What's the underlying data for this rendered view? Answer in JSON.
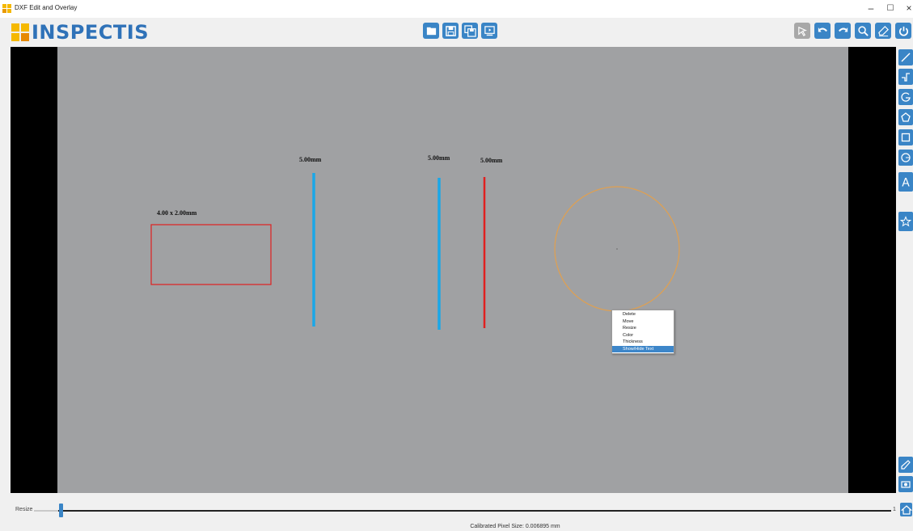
{
  "window": {
    "title": "DXF Edit and Overlay",
    "minimize": "–",
    "maximize": "☐",
    "close": "×"
  },
  "brand": {
    "logo_text": "INSPECTIS",
    "accent": "#2f72b8",
    "logo_color": "#f5b800"
  },
  "toolbar_center": [
    "folder-open-icon",
    "save-icon",
    "save-as-icon",
    "overlay-display-icon"
  ],
  "toolbar_right": [
    "select-arrow-icon",
    "undo-icon",
    "redo-icon",
    "zoom-icon",
    "eraser-icon",
    "power-icon"
  ],
  "side_tools": [
    "line-icon",
    "polyline-icon",
    "arc-icon",
    "polygon-icon",
    "rectangle-icon",
    "ellipse-icon",
    "text-icon",
    "star-icon"
  ],
  "side_bottom": [
    "pen-icon",
    "camera-overlay-icon"
  ],
  "drawing": {
    "labels": {
      "rect": "4.00 x 2.00mm",
      "line1": "5.00mm",
      "line2": "5.00mm",
      "line3": "5.00mm"
    },
    "colors": {
      "rect": "#e02020",
      "line1": "#1aa7e8",
      "line2": "#1aa7e8",
      "line3": "#e02020",
      "circle": "#e0a050",
      "background": "#a0a1a3"
    }
  },
  "context_menu": {
    "items": [
      "Delete",
      "Move",
      "Resize",
      "Color",
      "Thickness",
      "Show/Hide Text"
    ],
    "selected": "Show/Hide Text"
  },
  "bottom": {
    "resize_label": "Resize",
    "slider_value": "1",
    "status": "Calibrated Pixel Size: 0.006895 mm"
  }
}
